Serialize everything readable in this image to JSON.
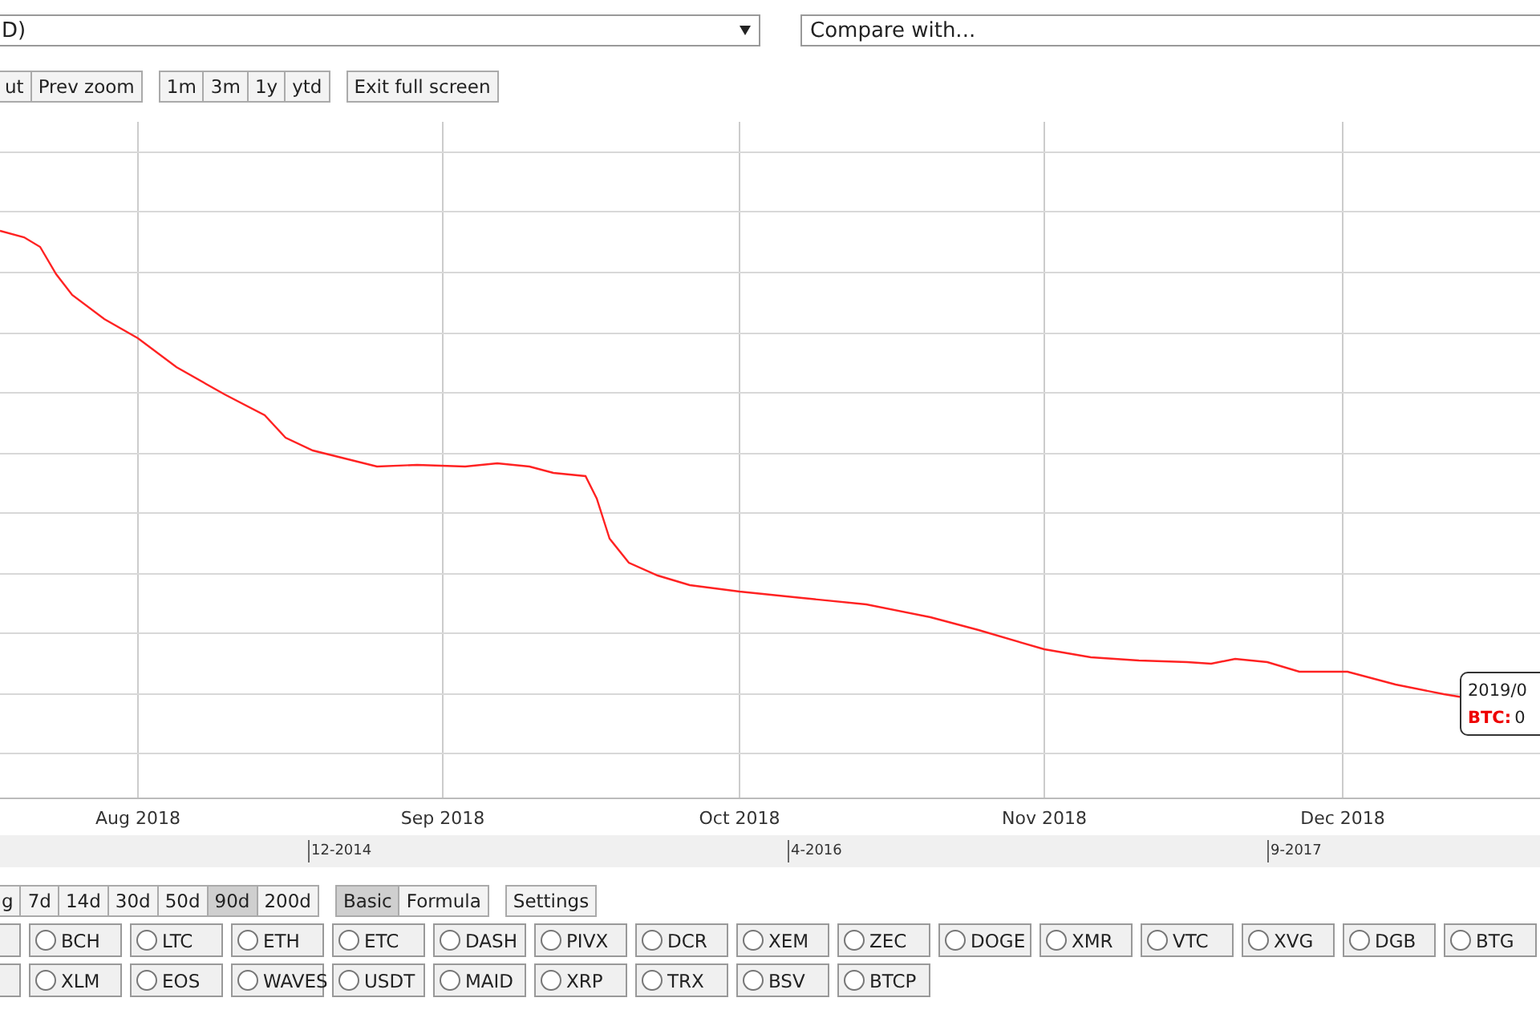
{
  "pair_select": {
    "value": "D)"
  },
  "compare_select": {
    "placeholder": "Compare with..."
  },
  "zoom_buttons": [
    "ut",
    "Prev zoom"
  ],
  "period_buttons": [
    "1m",
    "3m",
    "1y",
    "ytd"
  ],
  "fullscreen_button": "Exit full screen",
  "chart": {
    "x_labels": [
      "Aug 2018",
      "Sep 2018",
      "Oct 2018",
      "Nov 2018",
      "Dec 2018"
    ],
    "tooltip": {
      "date": "2019/0",
      "series": "BTC:",
      "value": "0"
    }
  },
  "navigator": {
    "labels": [
      "12-2014",
      "4-2016",
      "9-2017"
    ]
  },
  "ranges": [
    {
      "label": "g",
      "selected": false
    },
    {
      "label": "7d",
      "selected": false
    },
    {
      "label": "14d",
      "selected": false
    },
    {
      "label": "30d",
      "selected": false
    },
    {
      "label": "50d",
      "selected": false
    },
    {
      "label": "90d",
      "selected": true
    },
    {
      "label": "200d",
      "selected": false
    }
  ],
  "modes": [
    {
      "label": "Basic",
      "selected": true
    },
    {
      "label": "Formula",
      "selected": false
    }
  ],
  "settings_button": "Settings",
  "coins": [
    [
      "BCH",
      "LTC",
      "ETH",
      "ETC",
      "DASH",
      "PIVX",
      "DCR",
      "XEM",
      "ZEC",
      "DOGE",
      "XMR",
      "VTC",
      "XVG",
      "DGB",
      "BTG"
    ],
    [
      "XLM",
      "EOS",
      "WAVES",
      "USDT",
      "MAID",
      "XRP",
      "TRX",
      "BSV",
      "BTCP"
    ]
  ]
}
